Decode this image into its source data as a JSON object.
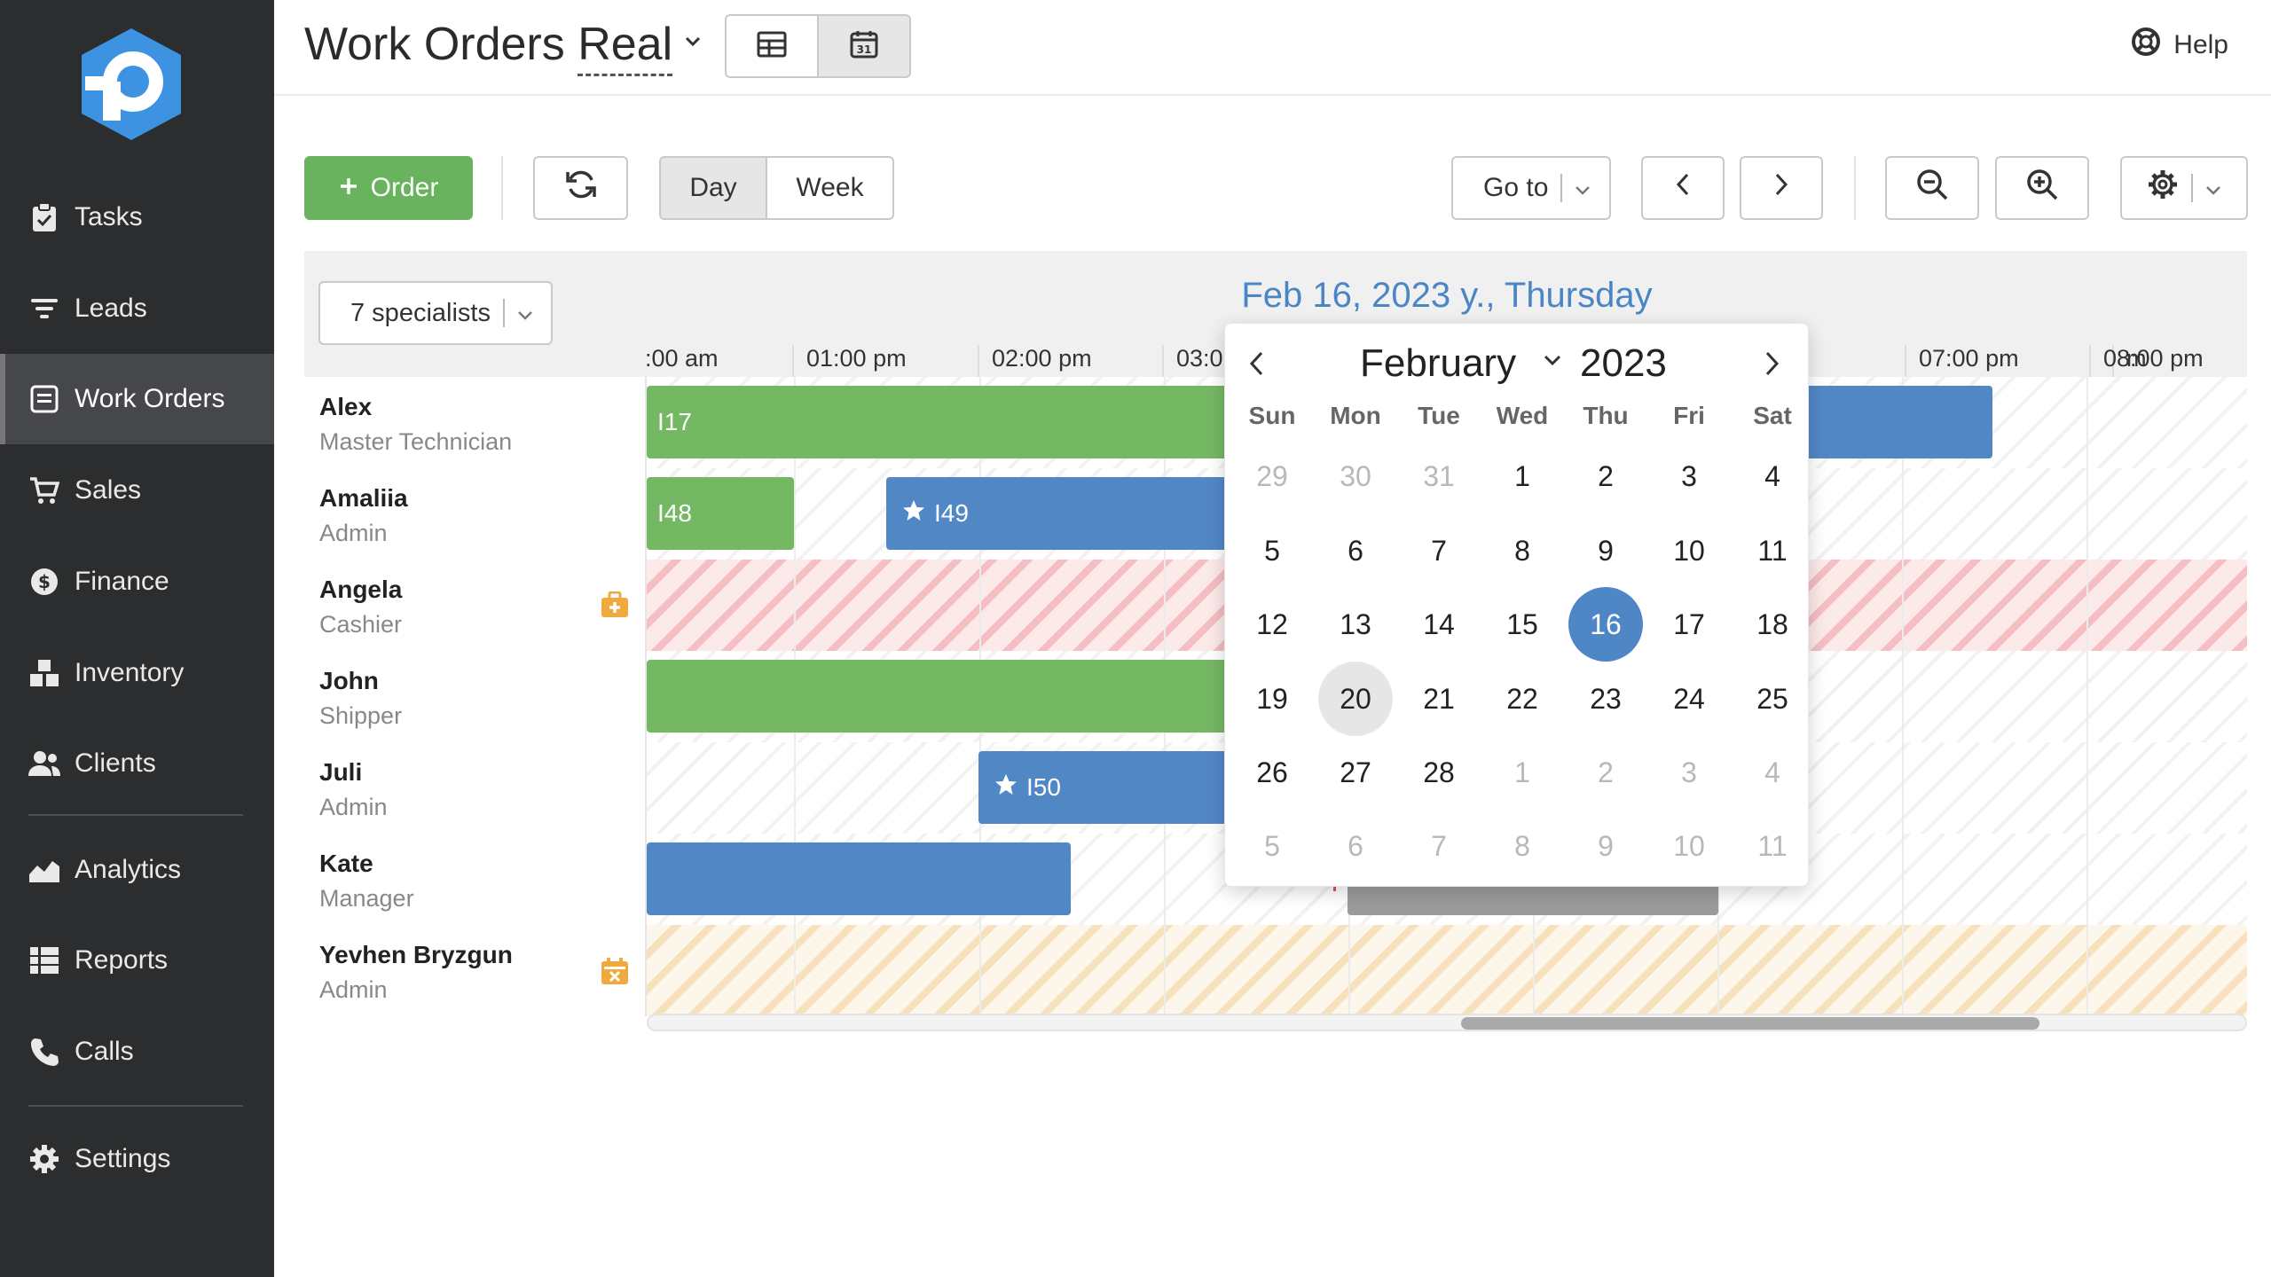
{
  "sidebar": {
    "items": [
      {
        "label": "Tasks",
        "icon": "clipboard-icon"
      },
      {
        "label": "Leads",
        "icon": "filter-icon"
      },
      {
        "label": "Work Orders",
        "icon": "work-orders-icon",
        "active": true
      },
      {
        "label": "Sales",
        "icon": "cart-icon"
      },
      {
        "label": "Finance",
        "icon": "dollar-icon"
      },
      {
        "label": "Inventory",
        "icon": "boxes-icon"
      },
      {
        "label": "Clients",
        "icon": "users-icon"
      },
      {
        "label": "Analytics",
        "icon": "chart-icon"
      },
      {
        "label": "Reports",
        "icon": "list-icon"
      },
      {
        "label": "Calls",
        "icon": "phone-icon"
      },
      {
        "label": "Settings",
        "icon": "gear-icon"
      }
    ]
  },
  "header": {
    "title": "Work Orders",
    "view_name": "Real",
    "help_label": "Help"
  },
  "toolbar": {
    "order_label": "Order",
    "day_label": "Day",
    "week_label": "Week",
    "goto_label": "Go to",
    "active_range": "Day"
  },
  "scheduler": {
    "specialists_label": "7 specialists",
    "date_label": "Feb 16, 2023 y., Thursday",
    "hours": [
      ":00 am",
      "01:00 pm",
      "02:00 pm",
      "03:0",
      "m",
      "07:00 pm",
      "08:00 pm"
    ],
    "resources": [
      {
        "name": "Alex",
        "role": "Master Technician"
      },
      {
        "name": "Amaliia",
        "role": "Admin"
      },
      {
        "name": "Angela",
        "role": "Cashier"
      },
      {
        "name": "John",
        "role": "Shipper"
      },
      {
        "name": "Juli",
        "role": "Admin"
      },
      {
        "name": "Kate",
        "role": "Manager"
      },
      {
        "name": "Yevhen Bryzgun",
        "role": "Admin"
      }
    ],
    "events": {
      "e117": "I17",
      "e148": "I48",
      "e149": "I49",
      "e150": "I50"
    }
  },
  "calendar": {
    "month": "February",
    "year": "2023",
    "weekdays": [
      "Sun",
      "Mon",
      "Tue",
      "Wed",
      "Thu",
      "Fri",
      "Sat"
    ],
    "weeks": [
      [
        "29",
        "30",
        "31",
        "1",
        "2",
        "3",
        "4"
      ],
      [
        "5",
        "6",
        "7",
        "8",
        "9",
        "10",
        "11"
      ],
      [
        "12",
        "13",
        "14",
        "15",
        "16",
        "17",
        "18"
      ],
      [
        "19",
        "20",
        "21",
        "22",
        "23",
        "24",
        "25"
      ],
      [
        "26",
        "27",
        "28",
        "1",
        "2",
        "3",
        "4"
      ],
      [
        "5",
        "6",
        "7",
        "8",
        "9",
        "10",
        "11"
      ]
    ],
    "selected_day": "16",
    "today_day": "20"
  },
  "colors": {
    "accent": "#4f86c6",
    "order_button": "#6ab35e",
    "event_green": "#75b864",
    "event_blue": "#5287c6",
    "sidebar": "#2b2d2f"
  }
}
